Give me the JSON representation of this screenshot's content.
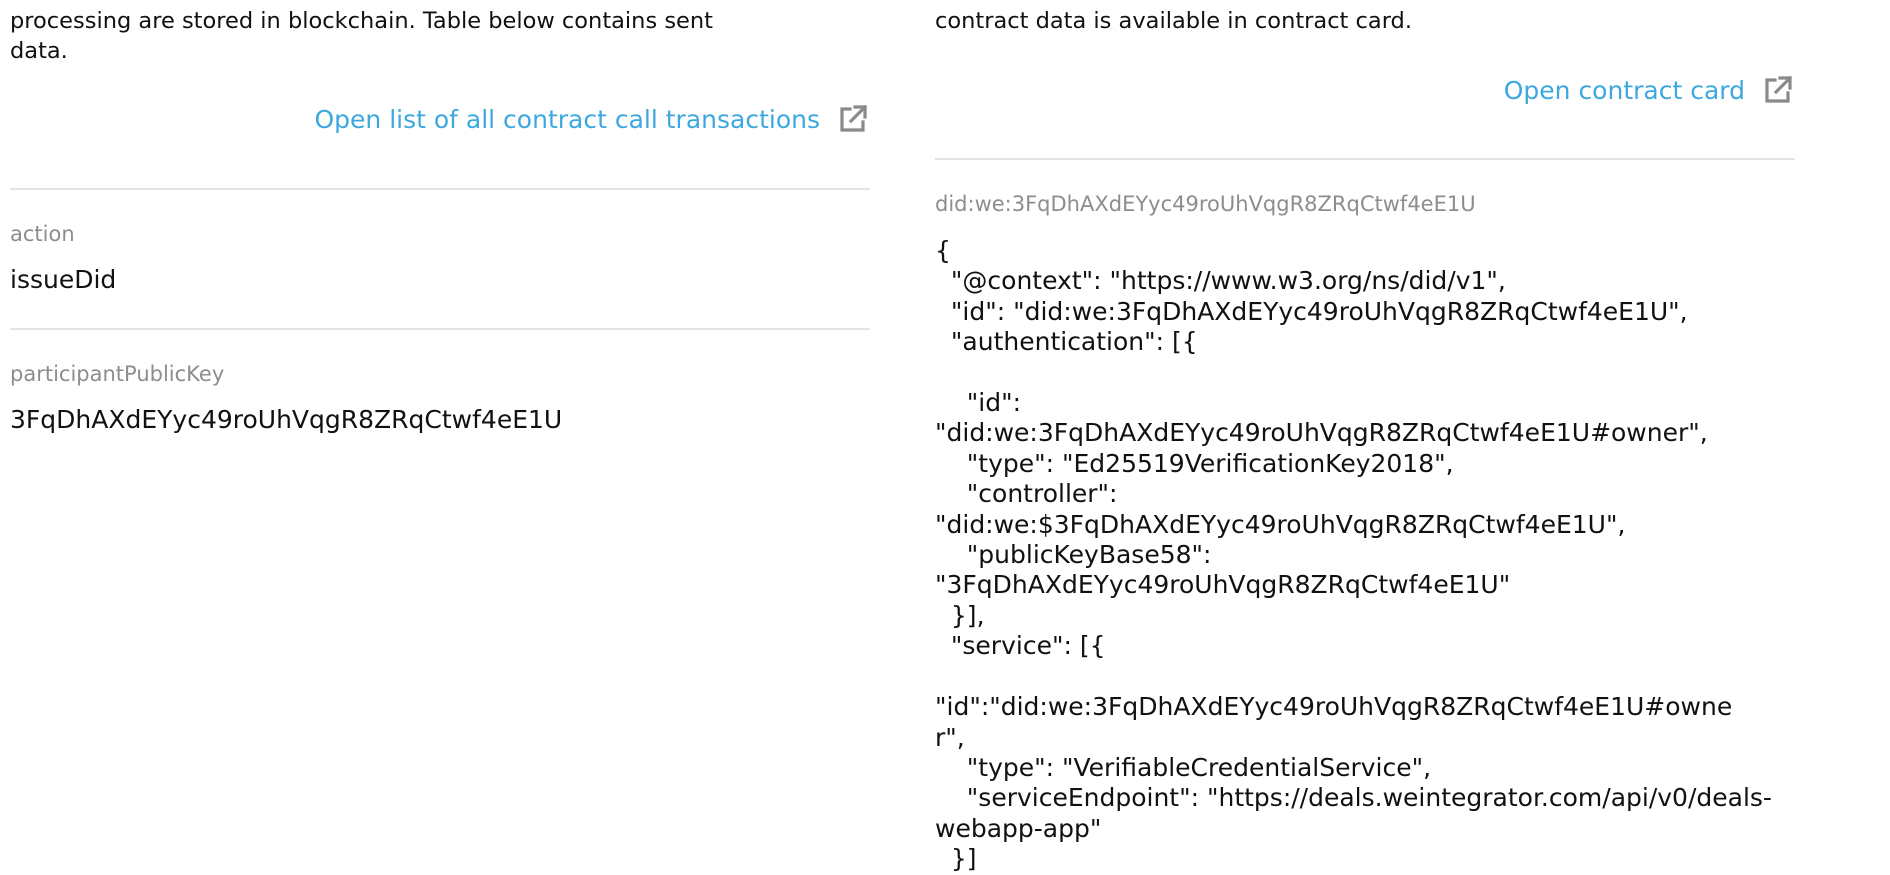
{
  "left": {
    "intro_text": "processing are stored in blockchain. Table below contains sent\ndata.",
    "open_transactions_link": "Open list of all contract call transactions",
    "fields": [
      {
        "label": "action",
        "value": "issueDid"
      },
      {
        "label": "participantPublicKey",
        "value": "3FqDhAXdEYyc49roUhVqgR8ZRqCtwf4eE1U"
      }
    ]
  },
  "right": {
    "intro_text": "contract data is available in contract card.",
    "open_contract_link": "Open contract card",
    "did_label": "did:we:3FqDhAXdEYyc49roUhVqgR8ZRqCtwf4eE1U",
    "did_document": "{\n  \"@context\": \"https://www.w3.org/ns/did/v1\",\n  \"id\": \"did:we:3FqDhAXdEYyc49roUhVqgR8ZRqCtwf4eE1U\",\n  \"authentication\": [{\n\n    \"id\":\n\"did:we:3FqDhAXdEYyc49roUhVqgR8ZRqCtwf4eE1U#owner\",\n    \"type\": \"Ed25519VerificationKey2018\",\n    \"controller\":\n\"did:we:$3FqDhAXdEYyc49roUhVqgR8ZRqCtwf4eE1U\",\n    \"publicKeyBase58\":\n\"3FqDhAXdEYyc49roUhVqgR8ZRqCtwf4eE1U\"\n  }],\n  \"service\": [{\n\n\"id\":\"did:we:3FqDhAXdEYyc49roUhVqgR8ZRqCtwf4eE1U#owne\nr\",\n    \"type\": \"VerifiableCredentialService\",\n    \"serviceEndpoint\": \"https://deals.weintegrator.com/api/v0/deals-\nwebapp-app\"\n  }]"
  },
  "icons": {
    "external_link": "external-link-icon"
  },
  "colors": {
    "link": "#3da8e0",
    "label": "#8d8d8d",
    "text": "#111111",
    "divider": "#e4e4e4"
  }
}
